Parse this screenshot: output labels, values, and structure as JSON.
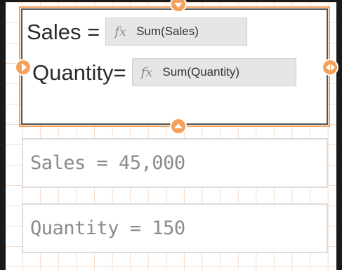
{
  "editor": {
    "rows": [
      {
        "label": "Sales =",
        "expression": "Sum(Sales)",
        "fx_icon": "fx"
      },
      {
        "label": "Quantity=",
        "expression": "Sum(Quantity)",
        "fx_icon": "fx"
      }
    ]
  },
  "kpis": [
    {
      "text": "Sales = 45,000"
    },
    {
      "text": "Quantity = 150"
    }
  ],
  "colors": {
    "accent": "#f5a15b",
    "grid": "#f7dcc7",
    "editor_border": "#555555",
    "kpi_text": "#8a8a8a"
  },
  "icons": [
    "resize-handle-top-icon",
    "resize-handle-left-icon",
    "resize-handle-right-icon",
    "resize-handle-bottom-icon",
    "fx-icon"
  ]
}
